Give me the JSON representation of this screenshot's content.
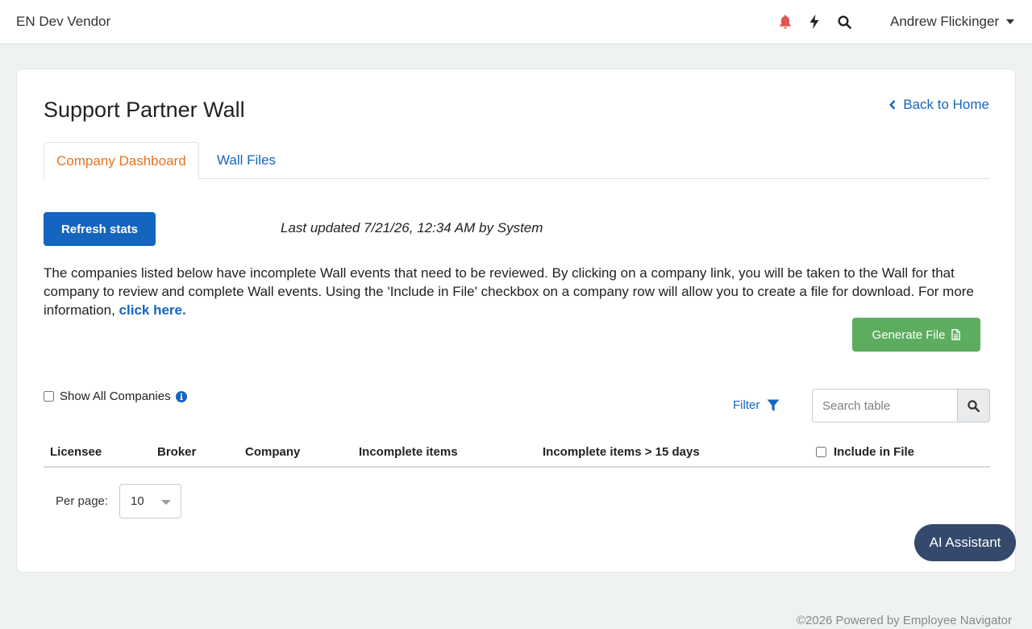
{
  "header": {
    "brand": "EN Dev Vendor",
    "user_name": "Andrew Flickinger",
    "icons": [
      "bell-icon",
      "bolt-icon",
      "search-icon"
    ],
    "bell_color": "#e05550"
  },
  "page": {
    "title": "Support Partner Wall",
    "back_link": "Back to Home"
  },
  "tabs": [
    {
      "label": "Company Dashboard",
      "active": true
    },
    {
      "label": "Wall Files",
      "active": false
    }
  ],
  "stats": {
    "refresh_label": "Refresh stats",
    "last_updated": "Last updated 7/21/26, 12:34 AM by System"
  },
  "description": {
    "text": "The companies listed below have incomplete Wall events that need to be reviewed. By clicking on a company link, you will be taken to the Wall for that company to review and complete Wall events. Using the 'Include in File' checkbox on a company row will allow you to create a file for download. For more information, ",
    "link": "click here."
  },
  "generate_file_label": "Generate File",
  "controls": {
    "show_all_label": "Show All Companies",
    "show_all_checked": false,
    "filter_label": "Filter",
    "search_placeholder": "Search table",
    "search_value": ""
  },
  "table": {
    "columns": [
      "Licensee",
      "Broker",
      "Company",
      "Incomplete items",
      "Incomplete items > 15 days",
      "Include in File"
    ],
    "rows": []
  },
  "pagination": {
    "per_page_label": "Per page:",
    "per_page_value": "10"
  },
  "ai_assistant_label": "AI Assistant",
  "footer": "©2026 Powered by Employee Navigator",
  "colors": {
    "primary": "#1565c0",
    "accent_tab": "#e8721c",
    "success": "#5cad5f",
    "ai_button": "#34496b"
  }
}
